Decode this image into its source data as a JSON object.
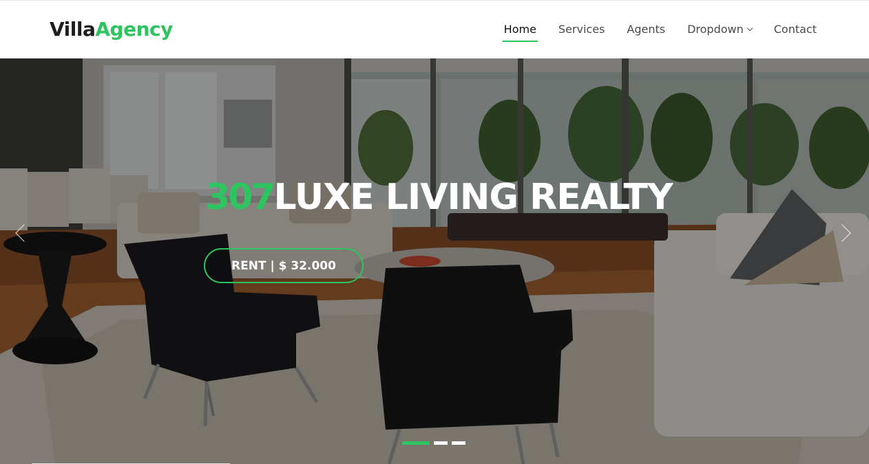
{
  "header": {
    "logo": {
      "first": "Villa",
      "second": "Agency"
    },
    "nav": [
      {
        "label": "Home",
        "active": true
      },
      {
        "label": "Services",
        "active": false
      },
      {
        "label": "Agents",
        "active": false
      },
      {
        "label": "Dropdown",
        "active": false,
        "has_submenu": true
      },
      {
        "label": "Contact",
        "active": false
      }
    ]
  },
  "hero": {
    "title_number": "307",
    "title_text": "LUXE LIVING REALTY",
    "button_label": "RENT | $ 32.000",
    "prev_icon": "chevron-left-icon",
    "next_icon": "chevron-right-icon",
    "slides_total": 3,
    "active_slide": 1
  },
  "colors": {
    "accent": "#2ec45f",
    "dark_text": "#1e1e1e"
  }
}
